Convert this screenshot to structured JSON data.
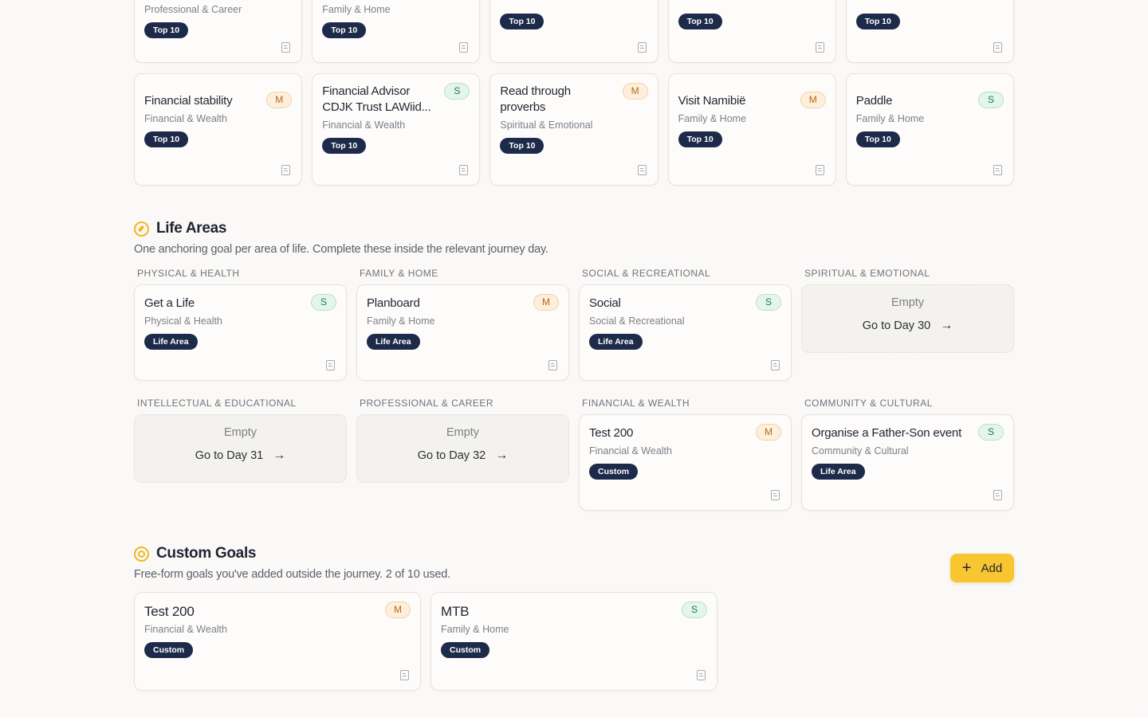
{
  "top10": {
    "row1": [
      {
        "category": "Professional & Career",
        "badge": "Top 10"
      },
      {
        "category": "Family & Home",
        "badge": "Top 10"
      },
      {
        "category": "",
        "badge": "Top 10"
      },
      {
        "category": "",
        "badge": "Top 10"
      },
      {
        "category": "",
        "badge": "Top 10"
      }
    ],
    "row2": [
      {
        "title": "Financial stability",
        "category": "Financial & Wealth",
        "badge": "Top 10",
        "size": "M"
      },
      {
        "title": "Financial Advisor CDJK Trust LAWiid...",
        "category": "Financial & Wealth",
        "badge": "Top 10",
        "size": "S"
      },
      {
        "title": "Read through proverbs",
        "category": "Spiritual & Emotional",
        "badge": "Top 10",
        "size": "M"
      },
      {
        "title": "Visit Namibië",
        "category": "Family & Home",
        "badge": "Top 10",
        "size": "M"
      },
      {
        "title": "Paddle",
        "category": "Family & Home",
        "badge": "Top 10",
        "size": "S"
      }
    ]
  },
  "life_areas": {
    "title": "Life Areas",
    "subtitle": "One anchoring goal per area of life. Complete these inside the relevant journey day.",
    "areas": [
      {
        "label": "PHYSICAL & HEALTH",
        "title": "Get a Life",
        "category": "Physical & Health",
        "badge": "Life Area",
        "size": "S"
      },
      {
        "label": "FAMILY & HOME",
        "title": "Planboard",
        "category": "Family & Home",
        "badge": "Life Area",
        "size": "M"
      },
      {
        "label": "SOCIAL & RECREATIONAL",
        "title": "Social",
        "category": "Social & Recreational",
        "badge": "Life Area",
        "size": "S"
      },
      {
        "label": "SPIRITUAL & EMOTIONAL",
        "empty": "Empty",
        "go": "Go to Day 30"
      },
      {
        "label": "INTELLECTUAL & EDUCATIONAL",
        "empty": "Empty",
        "go": "Go to Day 31"
      },
      {
        "label": "PROFESSIONAL & CAREER",
        "empty": "Empty",
        "go": "Go to Day 32"
      },
      {
        "label": "FINANCIAL & WEALTH",
        "title": "Test 200",
        "category": "Financial & Wealth",
        "badge": "Custom",
        "size": "M"
      },
      {
        "label": "COMMUNITY & CULTURAL",
        "title": "Organise a Father-Son event",
        "category": "Community & Cultural",
        "badge": "Life Area",
        "size": "S"
      }
    ]
  },
  "custom_goals": {
    "title": "Custom Goals",
    "subtitle": "Free-form goals you've added outside the journey. 2 of 10 used.",
    "add_label": "Add",
    "add_icon": "+",
    "items": [
      {
        "title": "Test 200",
        "category": "Financial & Wealth",
        "badge": "Custom",
        "size": "M"
      },
      {
        "title": "MTB",
        "category": "Family & Home",
        "badge": "Custom",
        "size": "S"
      }
    ]
  },
  "arrow_glyph": "→",
  "colors": {
    "accent": "#f8c630",
    "pill": "#1e2a4a",
    "size_m": "#b86a16",
    "size_s": "#1e7a4b"
  }
}
